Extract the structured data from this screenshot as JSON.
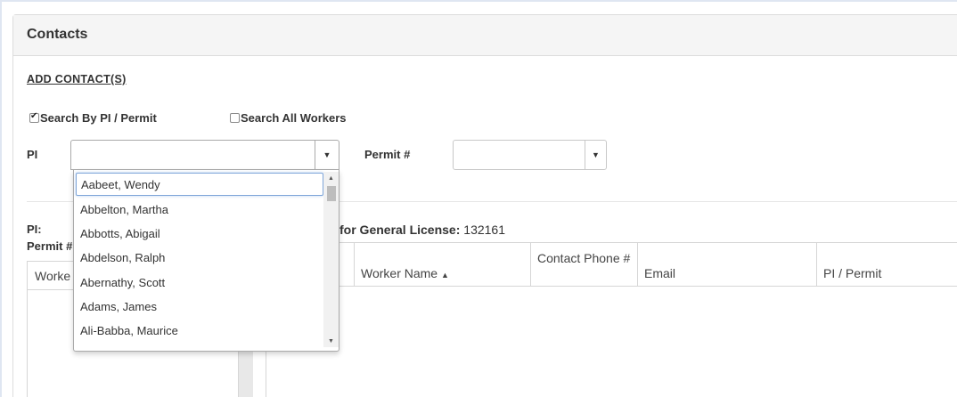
{
  "panel": {
    "title": "Contacts"
  },
  "add_contacts": {
    "label": "ADD CONTACT(S)"
  },
  "search_options": [
    {
      "label": "Search By PI / Permit",
      "checked": true
    },
    {
      "label": "Search All Workers",
      "checked": false
    }
  ],
  "filters": {
    "pi_label": "PI",
    "permit_label": "Permit #"
  },
  "details": {
    "pi_label": "PI:",
    "permit_label_partial": "Permit #",
    "general_license_label": "for General License:",
    "general_license_value": "132161",
    "left_list_header_partial": "Worke"
  },
  "table": {
    "columns": [
      {
        "label": "Worker Name",
        "sorted": "asc",
        "sort_icon": "▲"
      },
      {
        "label": "Contact Phone #"
      },
      {
        "label": "Email"
      },
      {
        "label": "PI / Permit"
      }
    ]
  },
  "dropdown": {
    "search_value": "Aabeet, Wendy",
    "options": [
      "Abbelton, Martha",
      "Abbotts, Abigail",
      "Abdelson, Ralph",
      "Abernathy, Scott",
      "Adams, James",
      "Ali-Babba, Maurice"
    ]
  },
  "icons": {
    "select_arrow": "▼",
    "scroll_up": "▲",
    "scroll_down": "▼"
  }
}
